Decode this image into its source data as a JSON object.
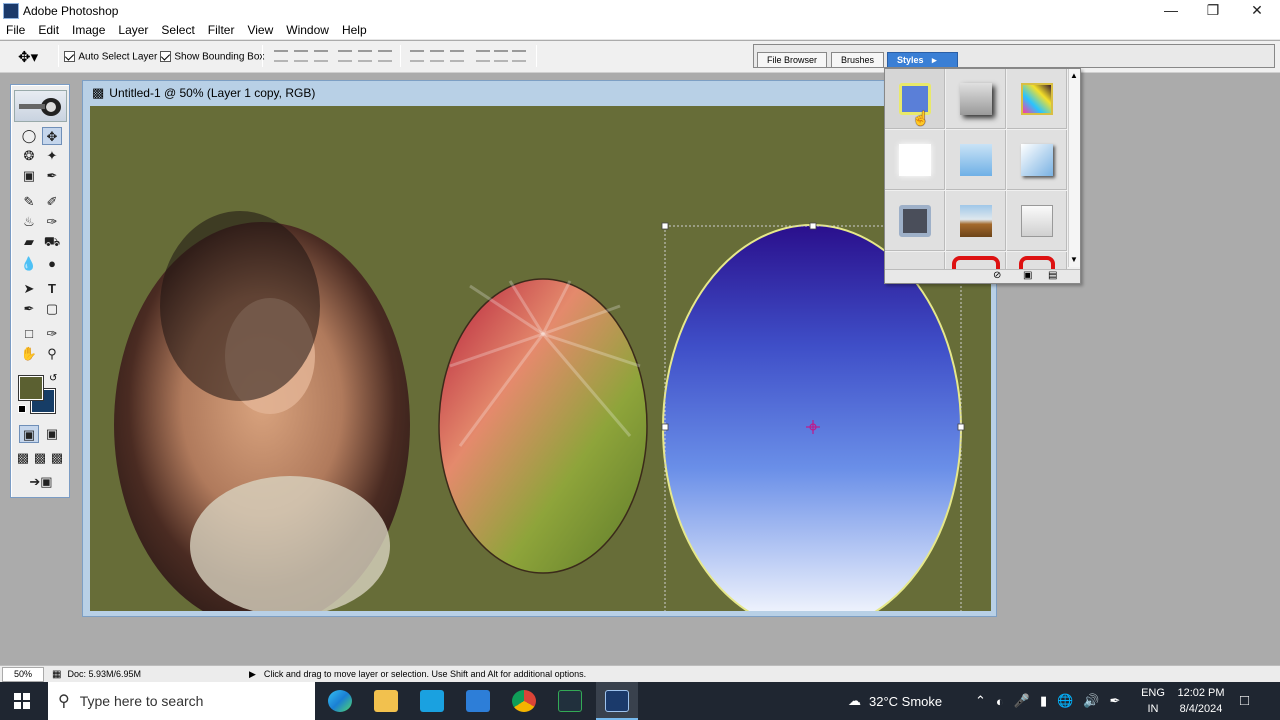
{
  "window": {
    "title": "Adobe Photoshop"
  },
  "menu": [
    "File",
    "Edit",
    "Image",
    "Layer",
    "Select",
    "Filter",
    "View",
    "Window",
    "Help"
  ],
  "options": {
    "auto_select": "Auto Select Layer",
    "bounding_box": "Show Bounding Box"
  },
  "palette_tabs": {
    "file_browser": "File Browser",
    "brushes": "Brushes",
    "styles": "Styles"
  },
  "document": {
    "title": "Untitled-1 @ 50% (Layer 1 copy, RGB)",
    "canvas_color": "#676d38"
  },
  "status": {
    "zoom": "50%",
    "doc": "Doc: 5.93M/6.95M",
    "hint": "Click and drag to move layer or selection.  Use Shift and Alt for additional options."
  },
  "taskbar": {
    "search_placeholder": "Type here to search",
    "weather": "32°C  Smoke",
    "lang1": "ENG",
    "lang2": "IN",
    "time": "12:02 PM",
    "date": "8/4/2024"
  },
  "colors": {
    "foreground": "#5b6031",
    "background": "#163d66",
    "accent": "#3a7fd5"
  }
}
